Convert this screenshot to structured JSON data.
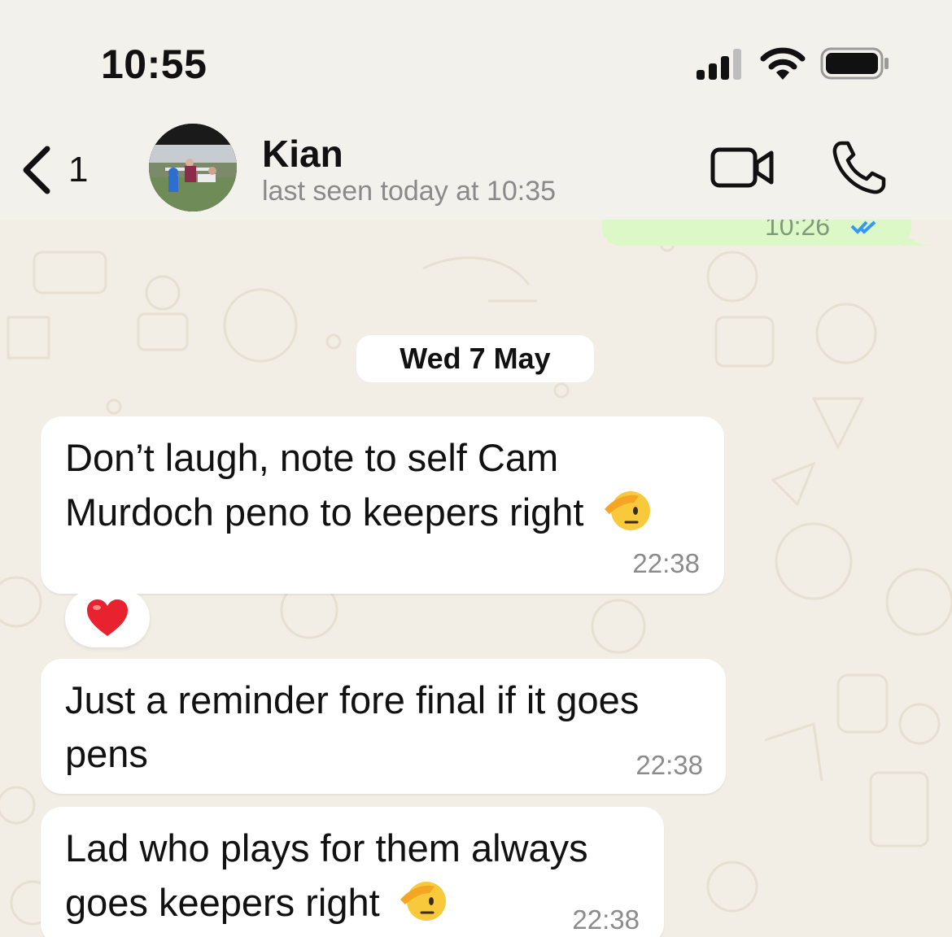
{
  "status_bar": {
    "time": "10:55"
  },
  "header": {
    "back_count": "1",
    "contact_name": "Kian",
    "last_seen": "last seen today at 10:35"
  },
  "chat": {
    "previous_message_time": "10:26",
    "date_separator": "Wed 7 May",
    "messages": [
      {
        "line1": "Don’t laugh, note to self Cam",
        "line2": "Murdoch peno to keepers right",
        "time": "22:38",
        "emoji": "saluting-face",
        "reaction": "red-heart"
      },
      {
        "line1": "Just a reminder fore final if it goes",
        "line2": "pens",
        "time": "22:38"
      },
      {
        "line1": "Lad who plays for them always",
        "line2": "goes keepers right",
        "time": "22:38",
        "emoji": "saluting-face"
      }
    ]
  },
  "colors": {
    "incoming_bubble": "#ffffff",
    "outgoing_bubble": "#dcf8c6",
    "wallpaper": "#f2eee6",
    "read_ticks": "#3497f9"
  }
}
